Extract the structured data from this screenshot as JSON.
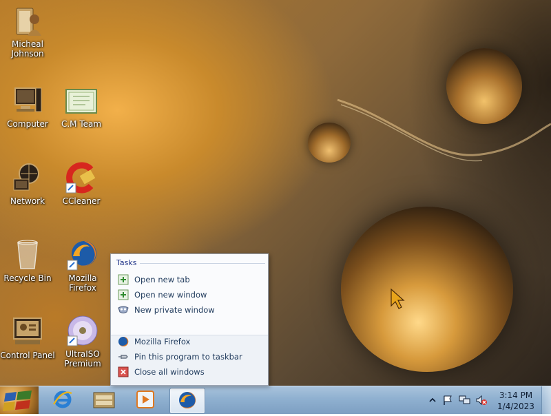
{
  "desktop": {
    "icons": [
      {
        "label": "Micheal Johnson",
        "icon": "user-folder-icon"
      },
      {
        "label": "Computer",
        "icon": "computer-icon"
      },
      {
        "label": "C.M Team",
        "icon": "certificate-icon"
      },
      {
        "label": "Network",
        "icon": "network-icon"
      },
      {
        "label": "CCleaner",
        "icon": "ccleaner-icon"
      },
      {
        "label": "Recycle Bin",
        "icon": "recycle-bin-icon"
      },
      {
        "label": "Mozilla Firefox",
        "icon": "firefox-icon"
      },
      {
        "label": "Control Panel",
        "icon": "control-panel-icon"
      },
      {
        "label": "UltraISO Premium",
        "icon": "disc-icon"
      }
    ]
  },
  "jumplist": {
    "header": "Tasks",
    "tasks": [
      {
        "label": "Open new tab",
        "icon": "new-tab-icon"
      },
      {
        "label": "Open new window",
        "icon": "new-window-icon"
      },
      {
        "label": "New private window",
        "icon": "private-window-icon"
      }
    ],
    "actions": [
      {
        "label": "Mozilla Firefox",
        "icon": "firefox-icon"
      },
      {
        "label": "Pin this program to taskbar",
        "icon": "pin-icon"
      },
      {
        "label": "Close all windows",
        "icon": "close-icon"
      }
    ]
  },
  "taskbar": {
    "pinned": [
      {
        "name": "internet-explorer",
        "icon": "internet-explorer-icon"
      },
      {
        "name": "file-cabinet",
        "icon": "file-cabinet-icon"
      },
      {
        "name": "media-player",
        "icon": "media-player-icon"
      },
      {
        "name": "firefox",
        "icon": "firefox-icon",
        "active": true
      }
    ],
    "clock": {
      "time": "3:14 PM",
      "date": "1/4/2023"
    }
  },
  "colors": {
    "taskbar": "#8fb0d0",
    "jumplist_bg": "#fafbfd",
    "link_text": "#1e395b"
  }
}
